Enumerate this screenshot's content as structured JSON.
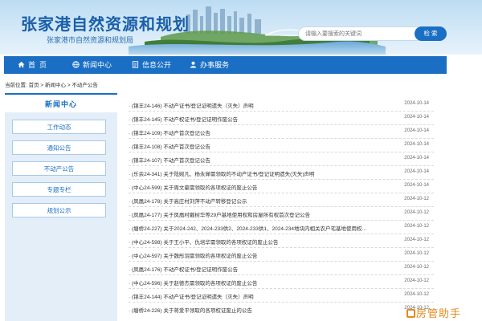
{
  "header": {
    "title": "张家港自然资源和规划",
    "subtitle": "张家港市自然资源和规划局",
    "search_placeholder": "请输入要搜索的关键词",
    "search_button": "检 索"
  },
  "nav": [
    {
      "label": "首  页",
      "icon": "home-icon"
    },
    {
      "label": "新闻中心",
      "icon": "globe-icon"
    },
    {
      "label": "信息公开",
      "icon": "document-icon"
    },
    {
      "label": "办事服务",
      "icon": "person-icon"
    }
  ],
  "breadcrumb": "当前位置: 首页 > 新闻中心 > 不动产公告",
  "sidebar": {
    "title": "新闻中心",
    "items": [
      "工作动态",
      "通知公告",
      "不动产公告",
      "专题专栏",
      "规划公示"
    ]
  },
  "news": [
    {
      "title": "· (锦丰24-146) 不动产证书/登记证明遗失（灭失）声明",
      "date": "2024-10-14"
    },
    {
      "title": "· (锦丰24-145) 不动产权证书/登记证明作废公告",
      "date": "2024-10-14"
    },
    {
      "title": "· (锦丰24-109) 不动产首次登记公告",
      "date": "2024-10-14"
    },
    {
      "title": "· (锦丰24-108) 不动产首次登记公告",
      "date": "2024-10-14"
    },
    {
      "title": "· (锦丰24-107) 不动产首次登记公告",
      "date": "2024-10-14"
    },
    {
      "title": "· (乐余24-341) 关于陆婉凡、杨永婵需领取的不动产证书/登记证明遗失(灭失)声明",
      "date": "2024-10-14"
    },
    {
      "title": "· (中心24-599) 关于周文豪需领取的各项权证的废止公告",
      "date": "2024-10-14"
    },
    {
      "title": "· (凤凰24-178) 关于高庄村刘萍不动产转移登记公示",
      "date": "2024-10-12"
    },
    {
      "title": "· (凤凰24-177) 关于凤凰村戴树华等29户基地使用权和房屋所有权首次登记公告",
      "date": "2024-10-12"
    },
    {
      "title": "· (塘桥24-227) 关于2024-242、2024-233供2、2024-233供1、2024-234地块内相关农户宅基地使用权…",
      "date": "2024-10-12"
    },
    {
      "title": "· (中心24-598) 关于王小平、仇培华需领取的各项权证的废止公告",
      "date": "2024-10-12"
    },
    {
      "title": "· (中心24-597) 关于魏彤羽需领取的各项权证的废止公告",
      "date": "2024-10-12"
    },
    {
      "title": "· (凤凰24-176) 不动产权证书/登记证明作废公告",
      "date": "2024-10-12"
    },
    {
      "title": "· (中心24-596) 关于赵德杰需领取的各项权证的废止公告",
      "date": "2024-10-12"
    },
    {
      "title": "· (锦丰24-144) 不动产证书/登记证明遗失（灭失）声明",
      "date": "2024-10-12"
    },
    {
      "title": "· (塘桥24-226) 关于蒋爱平领取的各项权证废止的公告",
      "date": "2024-10-12"
    }
  ],
  "watermark": "房管助手",
  "colors": {
    "primary": "#1a6fc4",
    "sidebar_bg": "#e3eef9",
    "watermark": "#e38a1f"
  }
}
